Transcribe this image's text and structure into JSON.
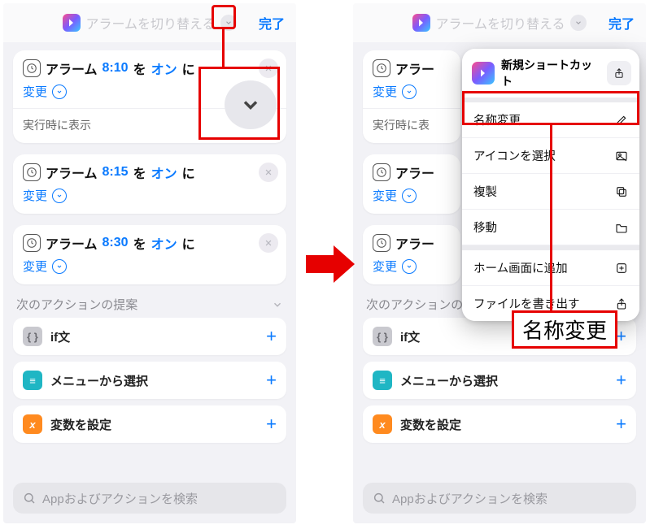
{
  "header": {
    "title": "アラームを切り替える",
    "done": "完了"
  },
  "alarms": [
    {
      "label": "アラーム",
      "time": "8:10",
      "wo": "を",
      "state": "オン",
      "ni": "に",
      "change": "変更",
      "runtime": "実行時に表示"
    },
    {
      "label": "アラーム",
      "time": "8:15",
      "wo": "を",
      "state": "オン",
      "ni": "に",
      "change": "変更"
    },
    {
      "label": "アラーム",
      "time": "8:30",
      "wo": "を",
      "state": "オン",
      "ni": "に",
      "change": "変更"
    }
  ],
  "suggestions": {
    "heading": "次のアクションの提案",
    "items": [
      {
        "icon": "gray",
        "glyph": "{ }",
        "label": "if文"
      },
      {
        "icon": "teal",
        "glyph": "≡",
        "label": "メニューから選択"
      },
      {
        "icon": "orange",
        "glyph": "x",
        "label": "変数を設定"
      }
    ]
  },
  "search": {
    "placeholder": "Appおよびアクションを検索"
  },
  "popover": {
    "title": "新規ショートカット",
    "rows": [
      {
        "label": "名称変更",
        "icon": "pencil"
      },
      {
        "label": "アイコンを選択",
        "icon": "image"
      },
      {
        "label": "複製",
        "icon": "duplicate"
      },
      {
        "label": "移動",
        "icon": "folder"
      },
      {
        "label": "ホーム画面に追加",
        "icon": "plus-box"
      },
      {
        "label": "ファイルを書き出す",
        "icon": "share"
      }
    ]
  },
  "callout": {
    "label": "名称変更"
  },
  "right_alarm_stub": {
    "label": "アラー",
    "change": "変更",
    "runtime": "実行時に表"
  }
}
